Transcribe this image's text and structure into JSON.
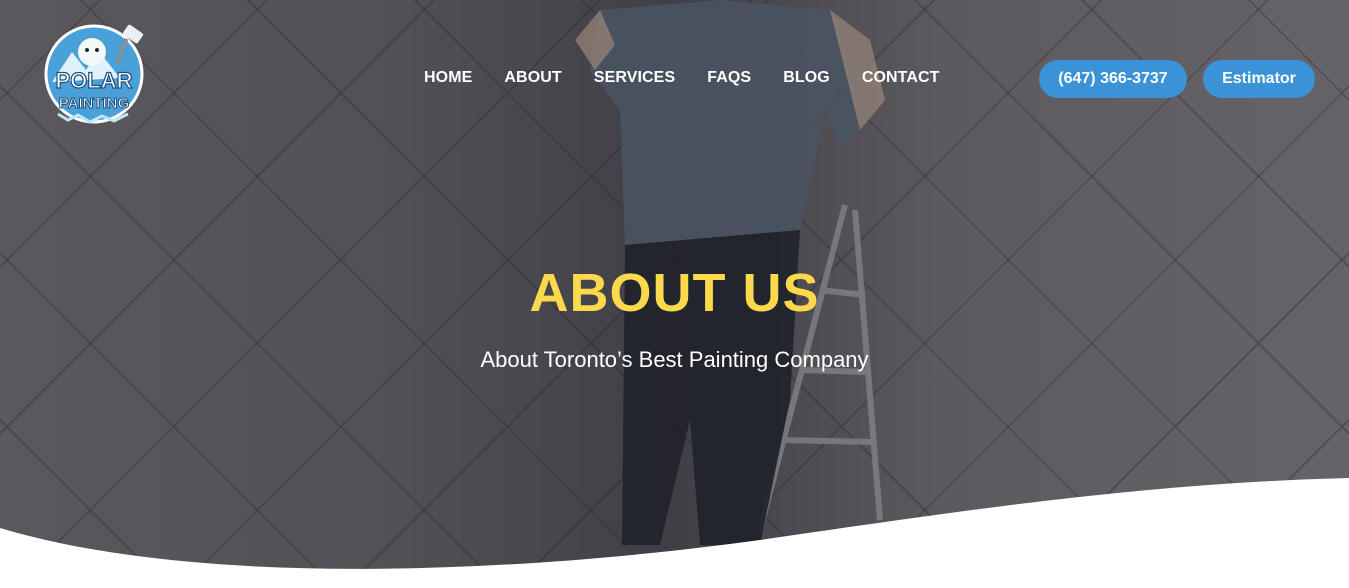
{
  "brand": {
    "logo_line1": "POLAR",
    "logo_line2": "PAINTING"
  },
  "nav": {
    "items": [
      {
        "label": "HOME"
      },
      {
        "label": "ABOUT"
      },
      {
        "label": "SERVICES"
      },
      {
        "label": "FAQS"
      },
      {
        "label": "BLOG"
      },
      {
        "label": "CONTACT"
      }
    ]
  },
  "header_actions": {
    "phone_label": "(647) 366-3737",
    "estimator_label": "Estimator"
  },
  "hero": {
    "title": "ABOUT US",
    "subtitle": "About Toronto’s Best Painting Company"
  },
  "colors": {
    "accent_blue": "#3a93d6",
    "title_yellow": "#fcd84c",
    "wave_white": "#ffffff"
  }
}
